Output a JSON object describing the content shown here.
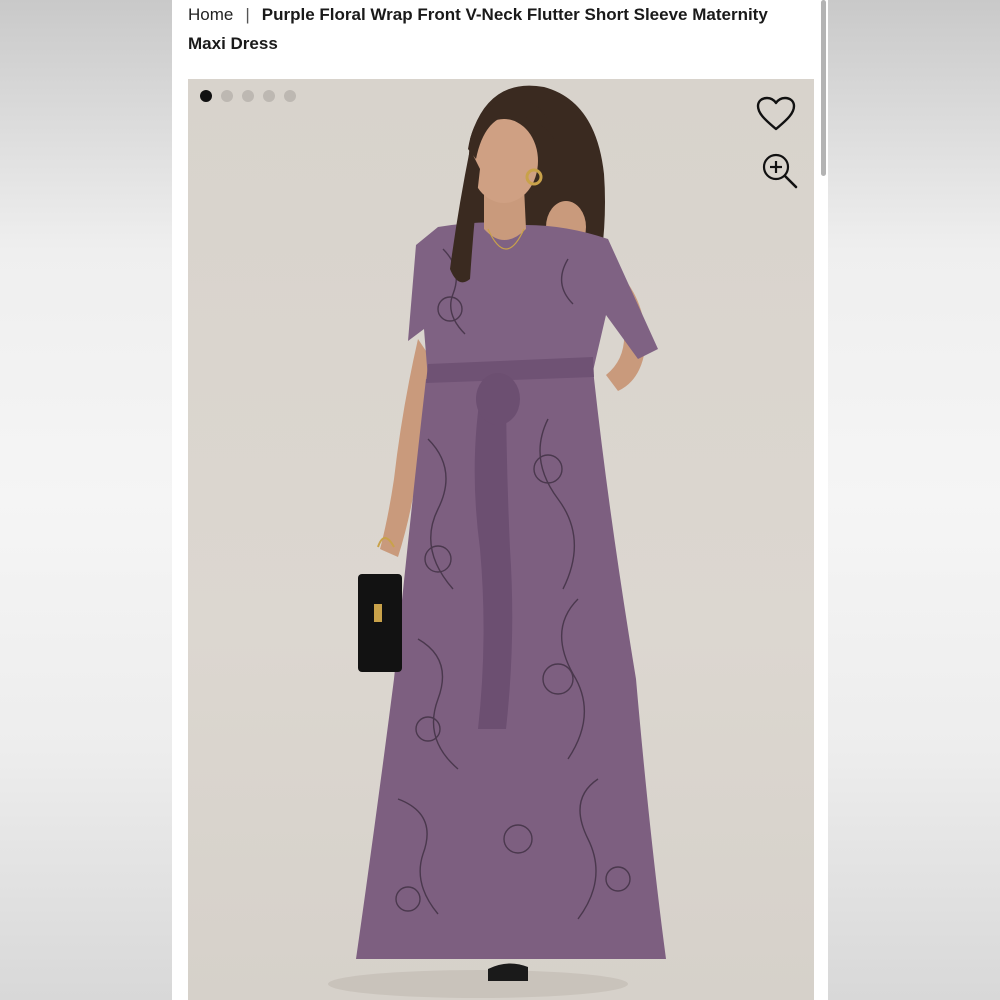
{
  "breadcrumb": {
    "home": "Home",
    "separator": "|",
    "current": "Purple Floral Wrap Front V-Neck Flutter Short Sleeve Maternity Maxi Dress"
  },
  "gallery": {
    "image_count": 5,
    "active_index": 0,
    "icons": {
      "favorite": "heart-icon",
      "zoom": "zoom-in-icon"
    }
  },
  "colors": {
    "dress": "#7d5f80",
    "background": "#d8d3cc",
    "active_dot": "#111111",
    "inactive_dot": "#bdb8b2"
  }
}
